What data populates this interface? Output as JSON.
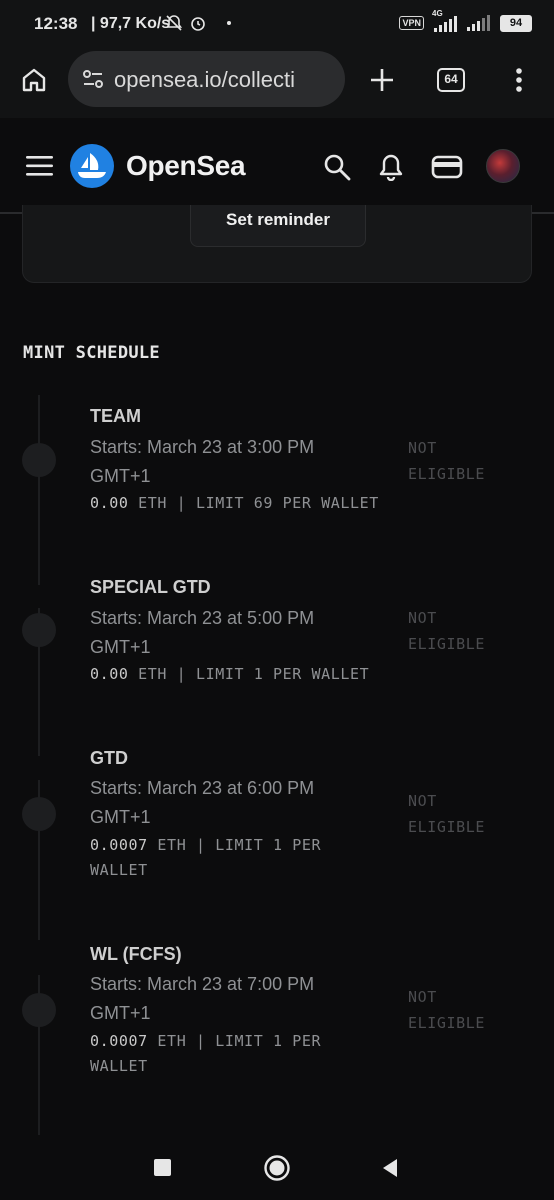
{
  "status_bar": {
    "time": "12:38",
    "speed": "| 97,7 Ko/s",
    "vpn": "VPN",
    "network": "4G",
    "battery": "94"
  },
  "browser": {
    "url": "opensea.io/collecti",
    "tab_count": "64"
  },
  "header": {
    "brand": "OpenSea",
    "brand_color": "#2081E2"
  },
  "reminder": {
    "button_label": "Set reminder"
  },
  "mint_schedule": {
    "title": "MINT SCHEDULE",
    "phases": [
      {
        "name": "TEAM",
        "time_line1": "Starts: March 23 at 3:00 PM",
        "time_line2": "GMT+1",
        "amount": "0.00",
        "price_rest": " ETH | LIMIT 69 PER WALLET",
        "status_line1": "NOT",
        "status_line2": "ELIGIBLE"
      },
      {
        "name": "SPECIAL GTD",
        "time_line1": "Starts: March 23 at 5:00 PM",
        "time_line2": "GMT+1",
        "amount": "0.00",
        "price_rest": " ETH | LIMIT 1 PER WALLET",
        "status_line1": "NOT",
        "status_line2": "ELIGIBLE"
      },
      {
        "name": "GTD",
        "time_line1": "Starts: March 23 at 6:00 PM",
        "time_line2": "GMT+1",
        "amount": "0.0007",
        "price_rest": " ETH | LIMIT 1 PER",
        "price_line2": "WALLET",
        "status_line1": "NOT",
        "status_line2": "ELIGIBLE"
      },
      {
        "name": "WL (FCFS)",
        "time_line1": "Starts: March 23 at 7:00 PM",
        "time_line2": "GMT+1",
        "amount": "0.0007",
        "price_rest": " ETH | LIMIT 1 PER",
        "price_line2": "WALLET",
        "status_line1": "NOT",
        "status_line2": "ELIGIBLE"
      }
    ]
  }
}
